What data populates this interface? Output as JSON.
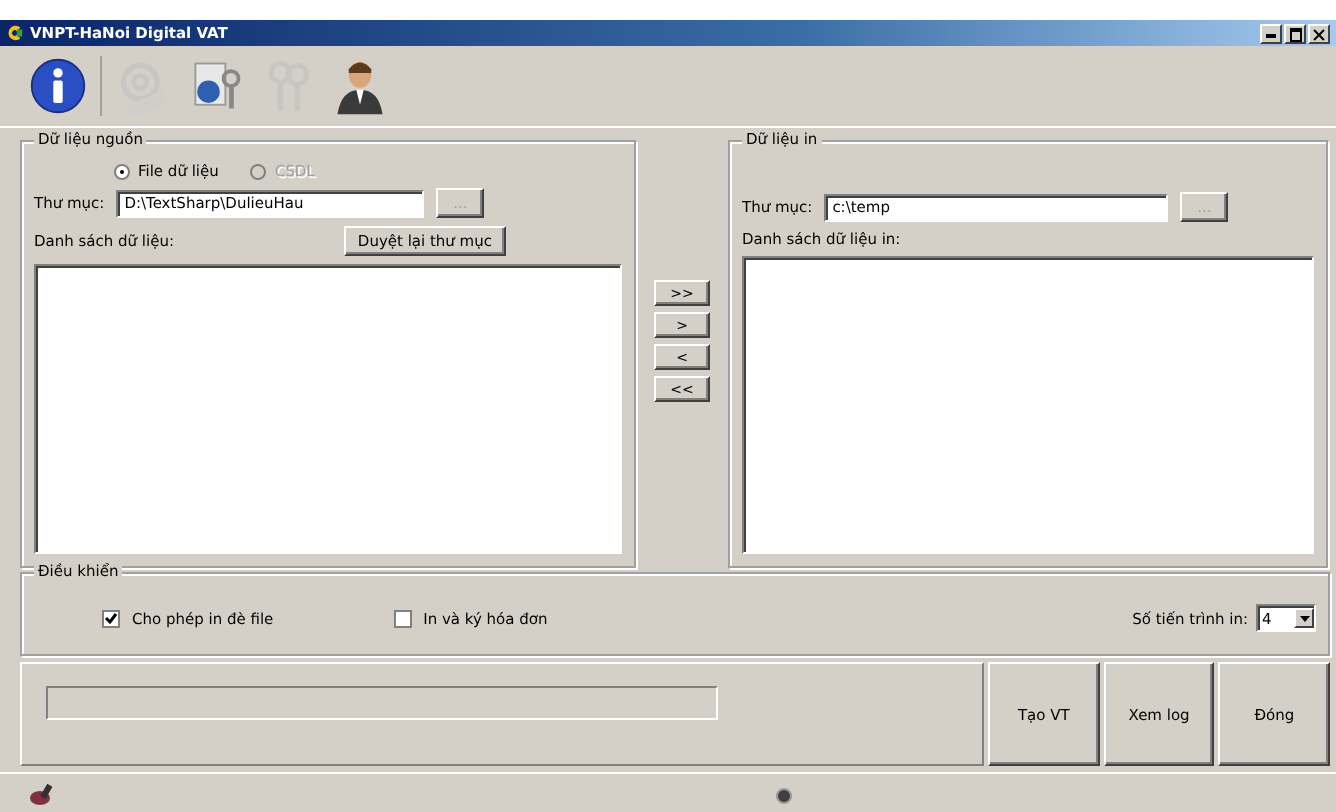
{
  "window": {
    "title": "VNPT-HaNoi Digital VAT"
  },
  "toolbar": [
    {
      "kind": "info",
      "disabled": false
    },
    {
      "kind": "email",
      "disabled": true
    },
    {
      "kind": "document-keys",
      "disabled": false
    },
    {
      "kind": "keys",
      "disabled": true
    },
    {
      "kind": "person",
      "disabled": false
    }
  ],
  "source": {
    "title": "Dữ liệu nguồn",
    "options": [
      {
        "label": "File dữ liệu",
        "selected": true,
        "disabled": false
      },
      {
        "label": "CSDL",
        "selected": false,
        "disabled": true
      }
    ],
    "folder_label": "Thư mục:",
    "folder": "D:\\TextSharp\\DulieuHau",
    "browse": "...",
    "list_label": "Danh sách dữ liệu:",
    "refresh": "Duyệt lại thư mục"
  },
  "transfer": [
    ">>",
    ">",
    "<",
    "<<"
  ],
  "output": {
    "title": "Dữ liệu in",
    "folder_label": "Thư mục:",
    "folder": "c:\\temp",
    "browse": "...",
    "list_label": "Danh sách dữ liệu in:"
  },
  "control": {
    "title": "Điều khiển",
    "checkboxes": [
      {
        "label": "Cho phép in đè file",
        "checked": true
      },
      {
        "label": "In và ký hóa đơn",
        "checked": false
      }
    ],
    "threads_label": "Số tiến trình in:",
    "threads": "4"
  },
  "buttons": [
    "Tạo VT",
    "Xem log",
    "Đóng"
  ]
}
